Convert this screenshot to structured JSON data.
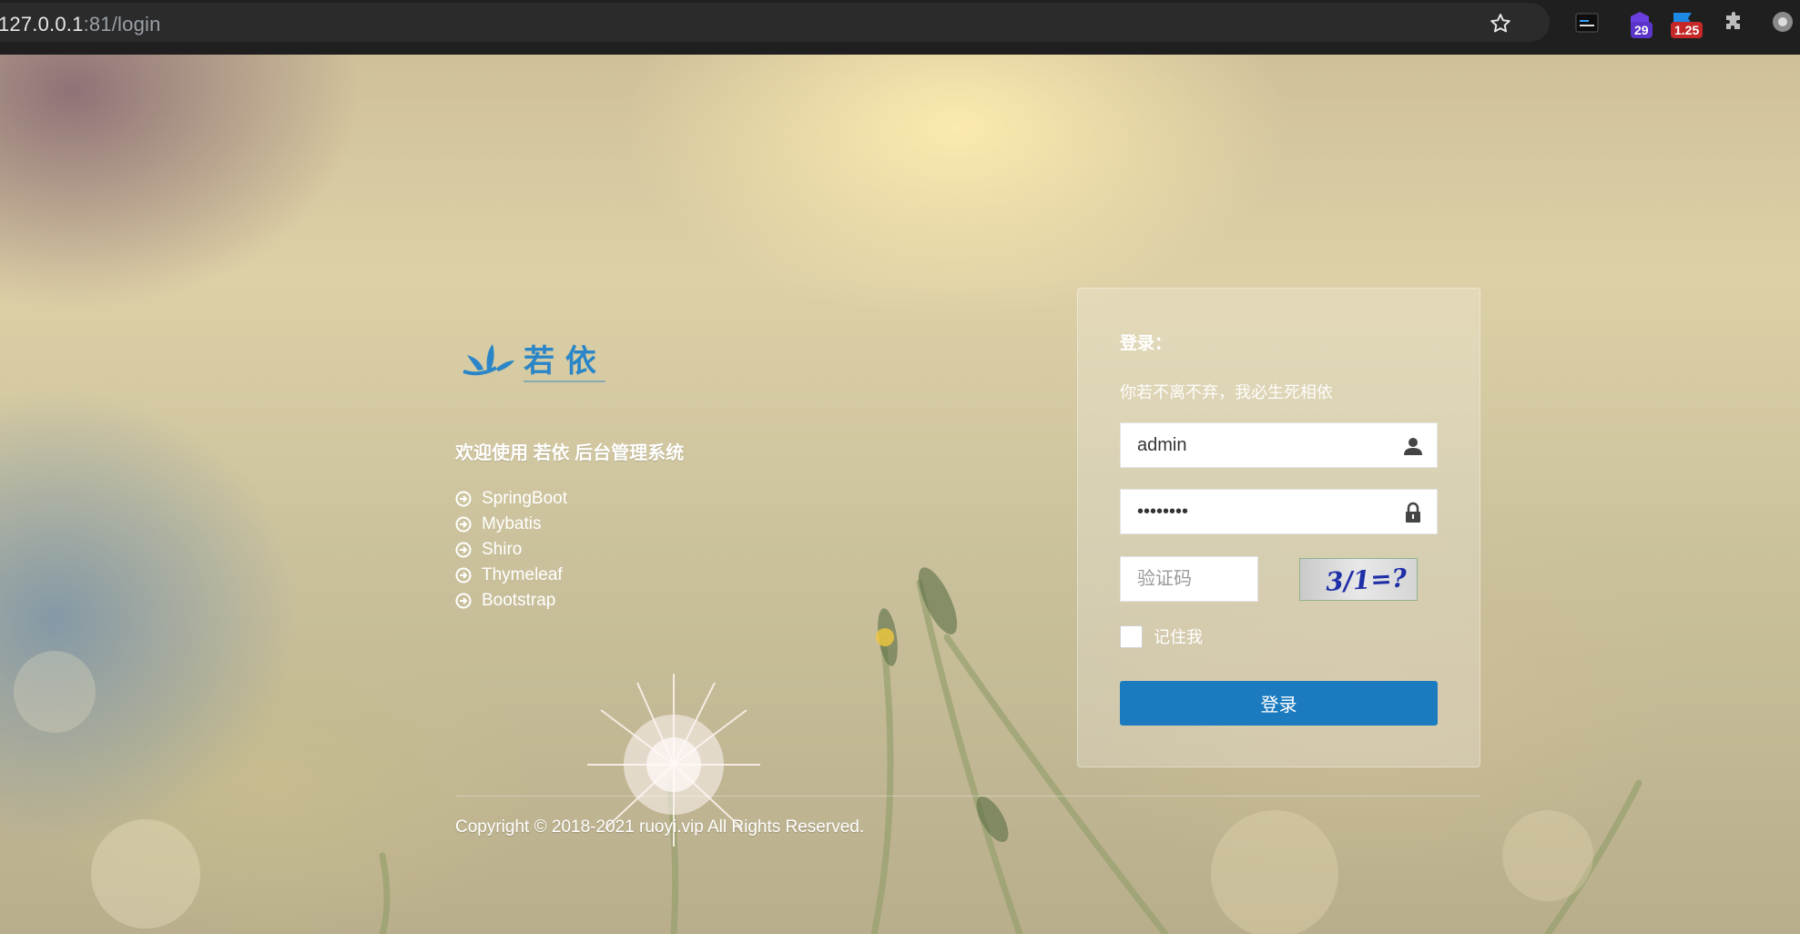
{
  "browser": {
    "url_host": "127.0.0.1",
    "url_rest": ":81/login",
    "extensions": [
      {
        "name": "terminal-extension-icon",
        "badge": ""
      },
      {
        "name": "shield-extension-icon",
        "badge": "29",
        "badge_color": "#5b35c9"
      },
      {
        "name": "flag-extension-icon",
        "badge": "1.25",
        "badge_color": "#c62828"
      },
      {
        "name": "puzzle-extension-icon",
        "badge": ""
      },
      {
        "name": "profile-avatar-icon",
        "badge": ""
      }
    ]
  },
  "brand": {
    "logo_text": "若 依",
    "welcome": "欢迎使用 若依 后台管理系统"
  },
  "tech_list": [
    "SpringBoot",
    "Mybatis",
    "Shiro",
    "Thymeleaf",
    "Bootstrap"
  ],
  "login": {
    "title": "登录：",
    "subtitle": "你若不离不弃，我必生死相依",
    "username_value": "admin",
    "password_value": "admin123",
    "captcha_placeholder": "验证码",
    "captcha_text": "3/1=?",
    "remember_label": "记住我",
    "submit_label": "登录"
  },
  "footer": {
    "copyright": "Copyright © 2018-2021 ruoyi.vip All Rights Reserved."
  },
  "colors": {
    "primary": "#1c7bbf",
    "logo_blue": "#2a86c8"
  }
}
